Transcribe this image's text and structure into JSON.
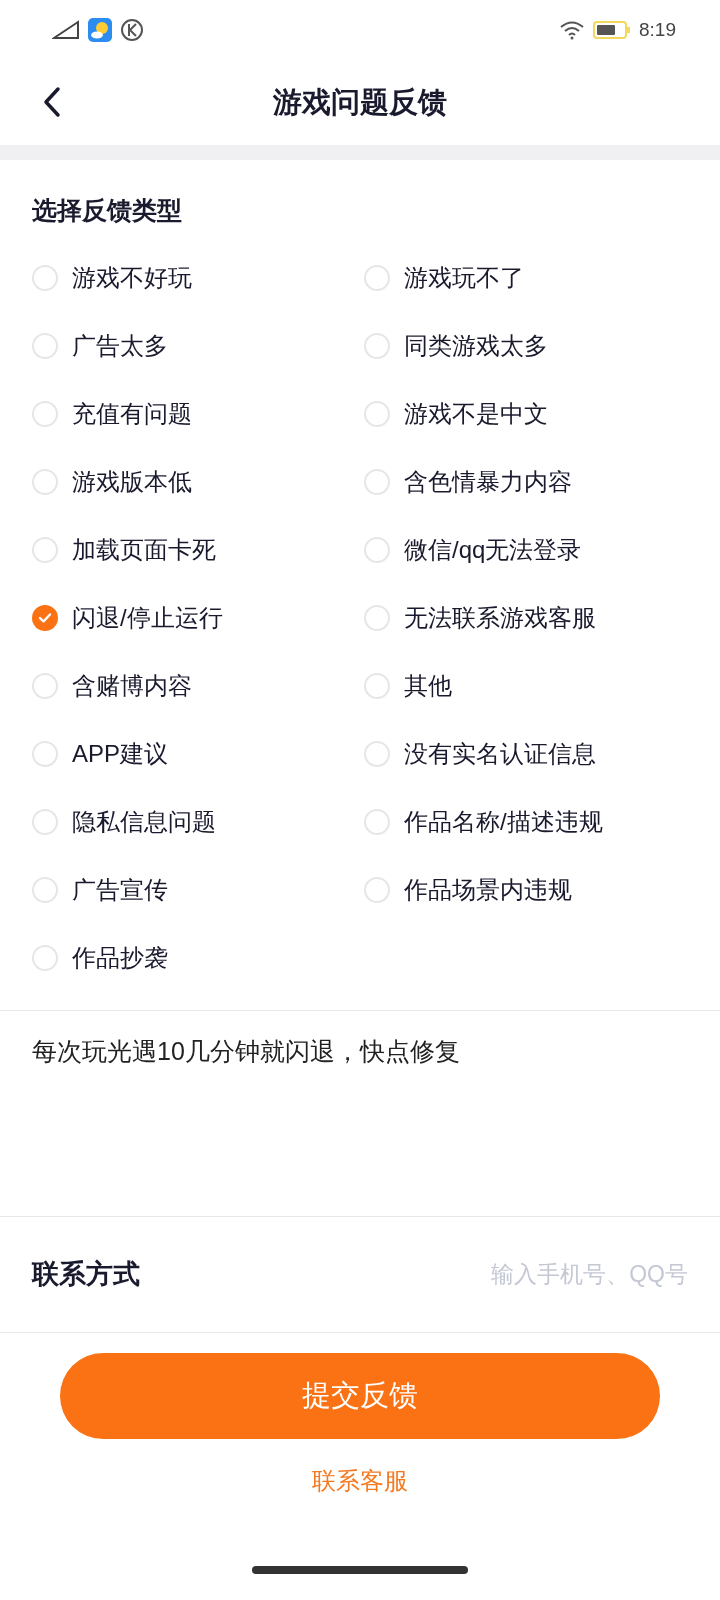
{
  "status_bar": {
    "time": "8:19"
  },
  "header": {
    "title": "游戏问题反馈"
  },
  "feedback_types": {
    "title": "选择反馈类型",
    "options": [
      {
        "label": "游戏不好玩",
        "selected": false
      },
      {
        "label": "游戏玩不了",
        "selected": false
      },
      {
        "label": "广告太多",
        "selected": false
      },
      {
        "label": "同类游戏太多",
        "selected": false
      },
      {
        "label": "充值有问题",
        "selected": false
      },
      {
        "label": "游戏不是中文",
        "selected": false
      },
      {
        "label": "游戏版本低",
        "selected": false
      },
      {
        "label": "含色情暴力内容",
        "selected": false
      },
      {
        "label": "加载页面卡死",
        "selected": false
      },
      {
        "label": "微信/qq无法登录",
        "selected": false
      },
      {
        "label": "闪退/停止运行",
        "selected": true
      },
      {
        "label": "无法联系游戏客服",
        "selected": false
      },
      {
        "label": "含赌博内容",
        "selected": false
      },
      {
        "label": "其他",
        "selected": false
      },
      {
        "label": "APP建议",
        "selected": false
      },
      {
        "label": "没有实名认证信息",
        "selected": false
      },
      {
        "label": "隐私信息问题",
        "selected": false
      },
      {
        "label": "作品名称/描述违规",
        "selected": false
      },
      {
        "label": "广告宣传",
        "selected": false
      },
      {
        "label": "作品场景内违规",
        "selected": false
      },
      {
        "label": "作品抄袭",
        "selected": false
      }
    ]
  },
  "description": {
    "value": "每次玩光遇10几分钟就闪退，快点修复"
  },
  "contact": {
    "label": "联系方式",
    "placeholder": "输入手机号、QQ号"
  },
  "submit_button": "提交反馈",
  "service_link": "联系客服"
}
